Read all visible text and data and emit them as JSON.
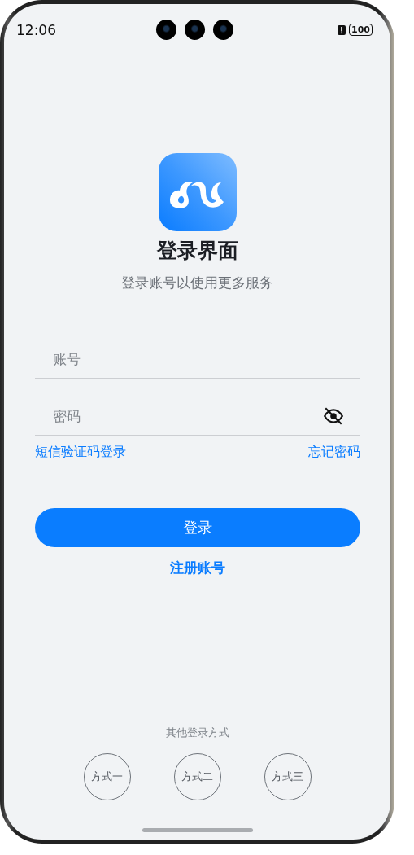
{
  "status_bar": {
    "time": "12:06",
    "battery": "100"
  },
  "header": {
    "title": "登录界面",
    "subtitle": "登录账号以使用更多服务"
  },
  "fields": [
    {
      "kind": "text",
      "placeholder": "账号"
    },
    {
      "kind": "password",
      "placeholder": "密码",
      "password_visible": false
    }
  ],
  "links": [
    {
      "label": "短信验证码登录"
    },
    {
      "label": "忘记密码"
    }
  ],
  "login_button": {
    "label": "登录"
  },
  "register_link": {
    "label": "注册账号"
  },
  "other_login": {
    "title": "其他登录方式",
    "methods": [
      {
        "label": "方式一"
      },
      {
        "label": "方式二"
      },
      {
        "label": "方式三"
      }
    ]
  }
}
